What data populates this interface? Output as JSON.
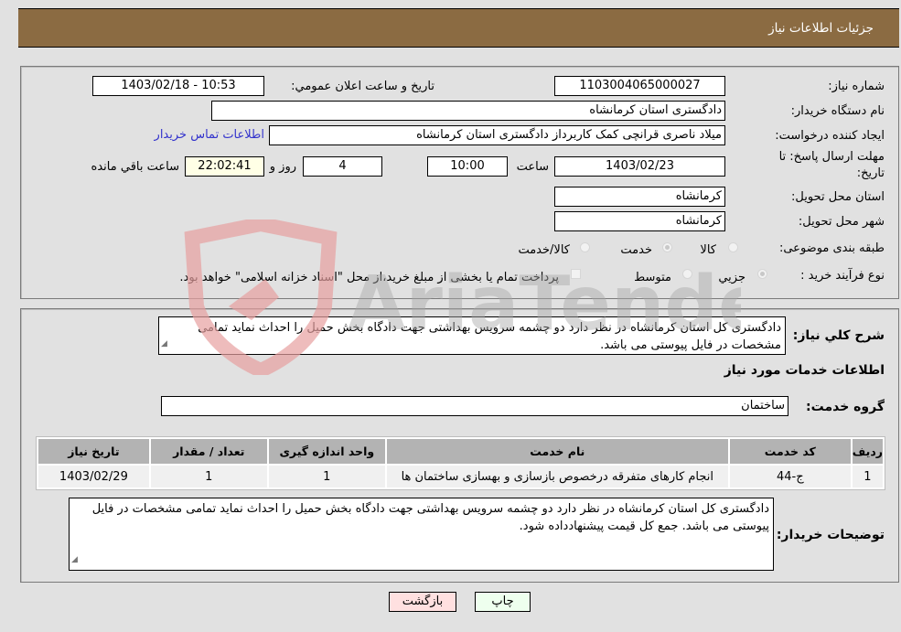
{
  "header": {
    "title": "جزئیات اطلاعات نیاز"
  },
  "form": {
    "need_number_label": "شماره نیاز:",
    "need_number": "1103004065000027",
    "announce_label": "تاریخ و ساعت اعلان عمومي:",
    "announce_value": "1403/02/18 - 10:53",
    "buyer_org_label": "نام دستگاه خریدار:",
    "buyer_org": "دادگستری استان کرمانشاه",
    "creator_label": "ایجاد کننده درخواست:",
    "creator": "میلاد ناصری قرانچی کمک کاربرداز دادگستری استان کرمانشاه",
    "contact_link": "اطلاعات تماس خریدار",
    "deadline_label_line1": "مهلت ارسال پاسخ: تا",
    "deadline_label_line2": "تاریخ:",
    "deadline_date": "1403/02/23",
    "time_label": "ساعت",
    "deadline_time": "10:00",
    "days_value": "4",
    "days_label": "روز و",
    "remaining_time": "22:02:41",
    "remaining_label": "ساعت باقي مانده",
    "province_label": "استان محل تحویل:",
    "province": "کرمانشاه",
    "city_label": "شهر محل تحویل:",
    "city": "کرمانشاه",
    "category_label": "طبقه بندی موضوعی:",
    "category_options": [
      {
        "label": "کالا",
        "selected": false
      },
      {
        "label": "خدمت",
        "selected": true
      },
      {
        "label": "کالا/خدمت",
        "selected": false
      }
    ],
    "process_label": "نوع فرآیند خرید :",
    "process_options": [
      {
        "label": "جزيي",
        "selected": true
      },
      {
        "label": "متوسط",
        "selected": false
      }
    ],
    "treasury_note": "پرداخت تمام یا بخشی از مبلغ خرید،از محل \"اسناد خزانه اسلامی\" خواهد بود.",
    "treasury_checked": false
  },
  "description": {
    "label": "شرح كلي نياز:",
    "text": "دادگستری کل استان کرمانشاه در نظر دارد  دو چشمه سرویس بهداشتی جهت دادگاه بخش حمیل را احداث نماید تمامی مشخصات در فایل پیوستی می باشد."
  },
  "services": {
    "section_title": "اطلاعات خدمات مورد نياز",
    "group_label": "گروه خدمت:",
    "group_value": "ساختمان",
    "columns": [
      "رديف",
      "كد خدمت",
      "نام خدمت",
      "واحد اندازه گيری",
      "تعداد / مقدار",
      "تاريخ نياز"
    ],
    "rows": [
      [
        "1",
        "ج-44",
        "انجام کارهای متفرقه درخصوص بازسازی و بهسازی ساختمان ها",
        "1",
        "1",
        "1403/02/29"
      ]
    ]
  },
  "buyer_notes": {
    "label": "توضیحات خریدار:",
    "text": "دادگستری کل استان کرمانشاه در نظر دارد  دو چشمه سرویس بهداشتی جهت دادگاه بخش حمیل را احداث نماید تمامی مشخصات در فایل پیوستی می باشد. جمع کل قیمت پیشنهادداده شود."
  },
  "buttons": {
    "print": "چاپ",
    "back": "بازگشت"
  },
  "watermark": {
    "text": "AriaTender.neT"
  },
  "colors": {
    "header": "#8b6b42",
    "back_button": "#ffe0e0",
    "print_button": "#eeffee",
    "link": "#3333cc"
  }
}
